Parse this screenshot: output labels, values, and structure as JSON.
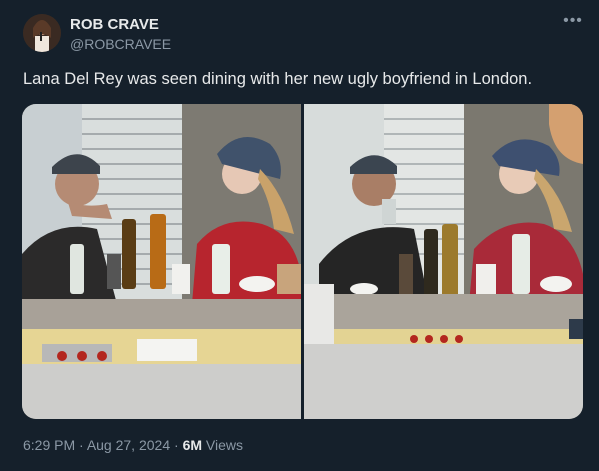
{
  "author": {
    "display_name": "ROB CRAVE",
    "handle": "@ROBCRAVEE"
  },
  "tweet": {
    "text": "Lana Del Rey was seen dining with her new ugly boyfriend in London."
  },
  "meta": {
    "time": "6:29 PM",
    "separator": " · ",
    "date": "Aug 27, 2024",
    "views_count": "6M",
    "views_label": " Views"
  },
  "icons": {
    "more": "more-options-icon"
  }
}
